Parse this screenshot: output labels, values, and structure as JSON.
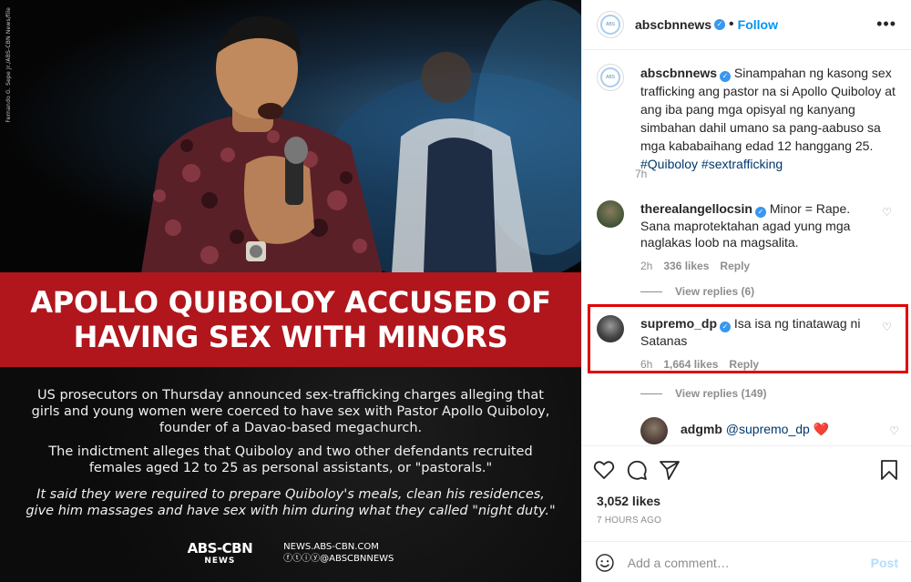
{
  "image": {
    "credit": "Fernando G. Sepe Jr./ABS-CBN News/file",
    "headline_lines": [
      "APOLLO QUIBOLOY ACCUSED OF",
      "HAVING SEX WITH MINORS"
    ],
    "paragraph1": "US prosecutors on Thursday announced sex-trafficking charges alleging that girls and young women were coerced to have sex with Pastor Apollo Quiboloy, founder of a Davao-based megachurch.",
    "paragraph2": "The indictment alleges that Quiboloy and two other defendants recruited females aged 12 to 25 as personal assistants, or \"pastorals.\"",
    "paragraph3": "It said they were required to prepare Quiboloy's meals, clean his residences, give him massages and have sex with him during what they called \"night duty.\"",
    "logo_top": "ABS-CBN",
    "logo_bottom": "NEWS",
    "url": "NEWS.ABS-CBN.COM",
    "social_handle": "@ABSCBNNEWS"
  },
  "header": {
    "username": "abscbnnews",
    "separator": "•",
    "follow_label": "Follow",
    "more_label": "•••"
  },
  "caption": {
    "username": "abscbnnews",
    "text": "Sinampahan ng kasong sex trafficking ang pastor na si Apollo Quiboloy at ang iba pang mga opisyal ng kanyang simbahan dahil umano sa pang-aabuso sa mga kababaihang edad 12 hanggang 25.",
    "hashtags": "#Quiboloy #sextrafficking",
    "time": "7h"
  },
  "comments": [
    {
      "username": "therealangellocsin",
      "text": "Minor = Rape. Sana maprotektahan agad yung mga naglakas loob na magsalita.",
      "time": "2h",
      "likes": "336 likes",
      "reply": "Reply",
      "view_replies": "View replies (6)"
    },
    {
      "username": "supremo_dp",
      "text": "Isa isa ng tinatawag ni Satanas",
      "time": "6h",
      "likes": "1,664 likes",
      "reply": "Reply",
      "view_replies": "View replies (149)"
    }
  ],
  "reply": {
    "username": "adgmb",
    "text": "@supremo_dp ❤️"
  },
  "actions": {
    "likes": "3,052 likes",
    "time_ago": "7 HOURS AGO",
    "comment_placeholder": "Add a comment…",
    "post_label": "Post"
  },
  "colors": {
    "verified": "#3897f0",
    "follow": "#0095f6",
    "highlight_box": "#e00000",
    "headline_band": "#b0161c"
  }
}
